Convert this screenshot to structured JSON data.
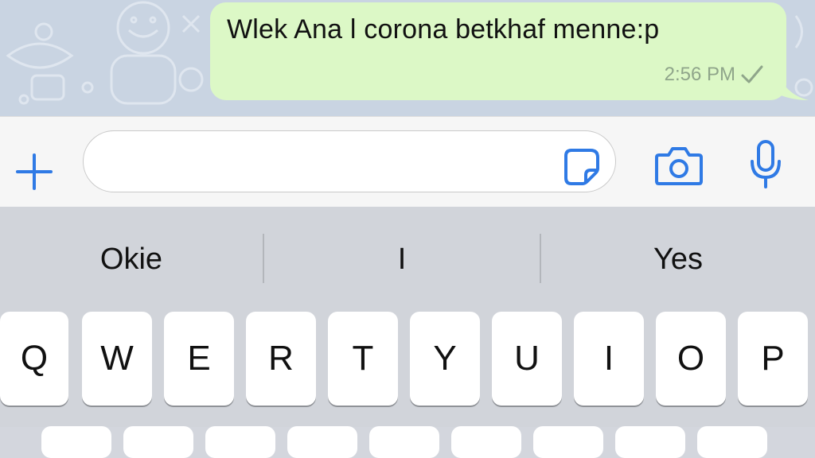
{
  "conversation": {
    "message": {
      "text": "Wlek Ana l corona betkhaf menne:p",
      "time": "2:56 PM",
      "status_icon": "single-check-icon"
    }
  },
  "composer": {
    "attach_icon": "plus-icon",
    "sticker_icon": "sticker-icon",
    "camera_icon": "camera-icon",
    "mic_icon": "microphone-icon",
    "input_value": "",
    "accent_color": "#2f7ae5"
  },
  "keyboard": {
    "suggestions": [
      "Okie",
      "I",
      "Yes"
    ],
    "top_row": [
      "Q",
      "W",
      "E",
      "R",
      "T",
      "Y",
      "U",
      "I",
      "O",
      "P"
    ]
  }
}
